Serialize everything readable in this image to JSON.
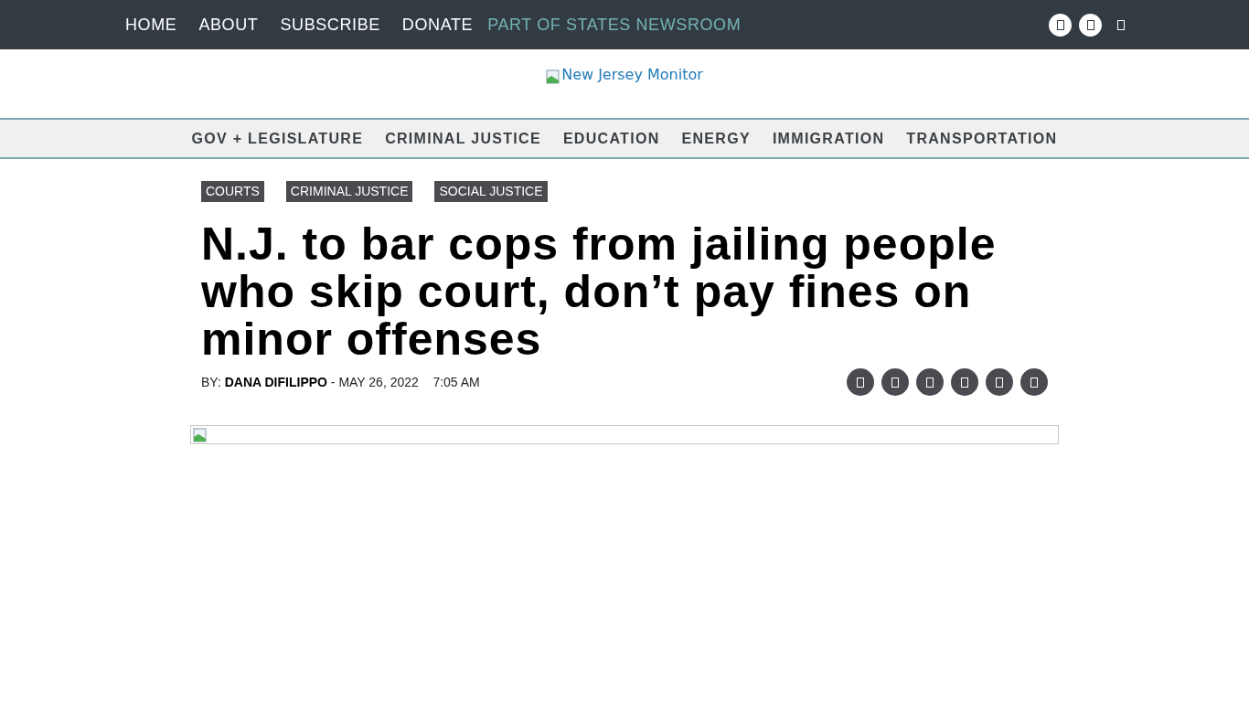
{
  "top_nav": {
    "links": [
      "HOME",
      "ABOUT",
      "SUBSCRIBE",
      "DONATE"
    ],
    "tagline": "PART OF STATES NEWSROOM",
    "icons": [
      {
        "kind": "circle"
      },
      {
        "kind": "circle"
      },
      {
        "kind": "plain"
      }
    ]
  },
  "logo": {
    "alt": "New Jersey Monitor"
  },
  "sections": [
    "GOV + LEGISLATURE",
    "CRIMINAL JUSTICE",
    "EDUCATION",
    "ENERGY",
    "IMMIGRATION",
    "TRANSPORTATION"
  ],
  "article": {
    "tags": [
      "COURTS",
      "CRIMINAL JUSTICE",
      "SOCIAL JUSTICE"
    ],
    "headline": "N.J. to bar cops from jailing people who skip court, don’t pay fines on minor offenses",
    "byline_label": "BY:",
    "author": "DANA DIFILIPPO",
    "date": "- MAY 26, 2022",
    "time": "7:05 AM"
  }
}
